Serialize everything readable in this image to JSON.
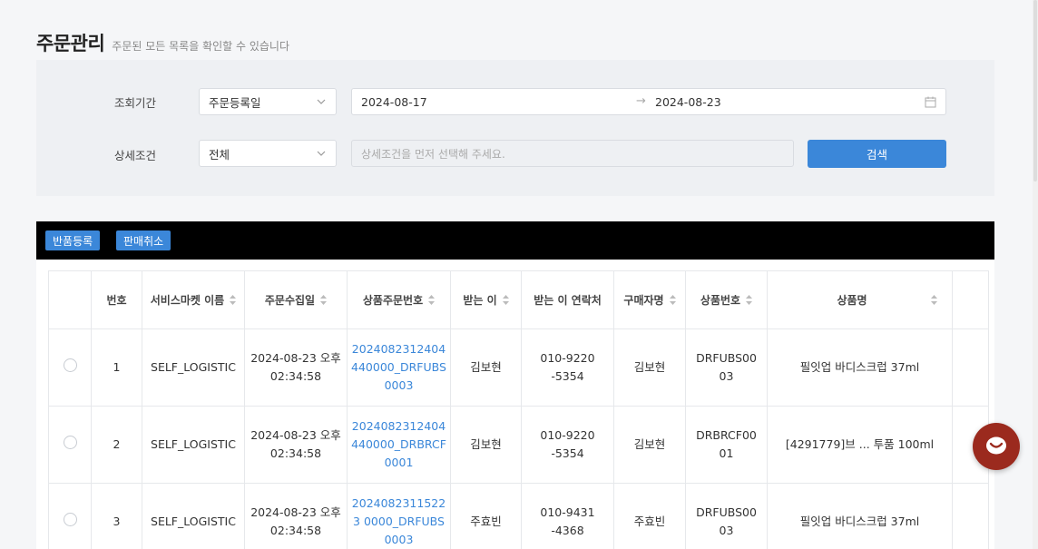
{
  "header": {
    "title": "주문관리",
    "subtitle": "주문된 모든 목록을 확인할 수 있습니다"
  },
  "filters": {
    "period_label": "조회기간",
    "period_select": "주문등록일",
    "date_start": "2024-08-17",
    "date_arrow": "→",
    "date_end": "2024-08-23",
    "detail_label": "상세조건",
    "detail_select": "전체",
    "detail_placeholder": "상세조건을 먼저 선택해 주세요.",
    "search_label": "검색"
  },
  "actions": {
    "return_register": "반품등록",
    "cancel_sale": "판매취소"
  },
  "table": {
    "columns": [
      {
        "label": "",
        "sortable": false
      },
      {
        "label": "번호",
        "sortable": false
      },
      {
        "label": "서비스마켓 이름",
        "sortable": true
      },
      {
        "label": "주문수집일",
        "sortable": true
      },
      {
        "label": "상품주문번호",
        "sortable": true
      },
      {
        "label": "받는 이",
        "sortable": true
      },
      {
        "label": "받는 이 연락처",
        "sortable": false
      },
      {
        "label": "구매자명",
        "sortable": true
      },
      {
        "label": "상품번호",
        "sortable": true
      },
      {
        "label": "상품명",
        "sortable": true
      },
      {
        "label": "",
        "sortable": false
      }
    ],
    "rows": [
      {
        "no": "1",
        "market": "SELF_LOGISTIC",
        "collected": "2024-08-23 오후 02:34:58",
        "order_no": "2024082312404440000_DRFUBS0003",
        "receiver": "김보현",
        "phone": "010-9220-5354",
        "buyer": "김보현",
        "product_no": "DRFUBS0003",
        "product_name": "필잇업 바디스크럽 37ml"
      },
      {
        "no": "2",
        "market": "SELF_LOGISTIC",
        "collected": "2024-08-23 오후 02:34:58",
        "order_no": "2024082312404440000_DRBRCF0001",
        "receiver": "김보현",
        "phone": "010-9220-5354",
        "buyer": "김보현",
        "product_no": "DRBRCF0001",
        "product_name": "[4291779]브 ... 투품 100ml"
      },
      {
        "no": "3",
        "market": "SELF_LOGISTIC",
        "collected": "2024-08-23 오후 02:34:58",
        "order_no": "20240823115223 0000_DRFUBS0003",
        "receiver": "주효빈",
        "phone": "010-9431-4368",
        "buyer": "주효빈",
        "product_no": "DRFUBS0003",
        "product_name": "필잇업 바디스크럽 37ml"
      }
    ]
  },
  "colors": {
    "accent": "#3b87d9",
    "chat": "#9b2a1e"
  },
  "icons": {
    "chevron": "chevron-down-icon",
    "calendar": "calendar-icon",
    "sort": "sort-icon",
    "chat": "chat-icon"
  }
}
